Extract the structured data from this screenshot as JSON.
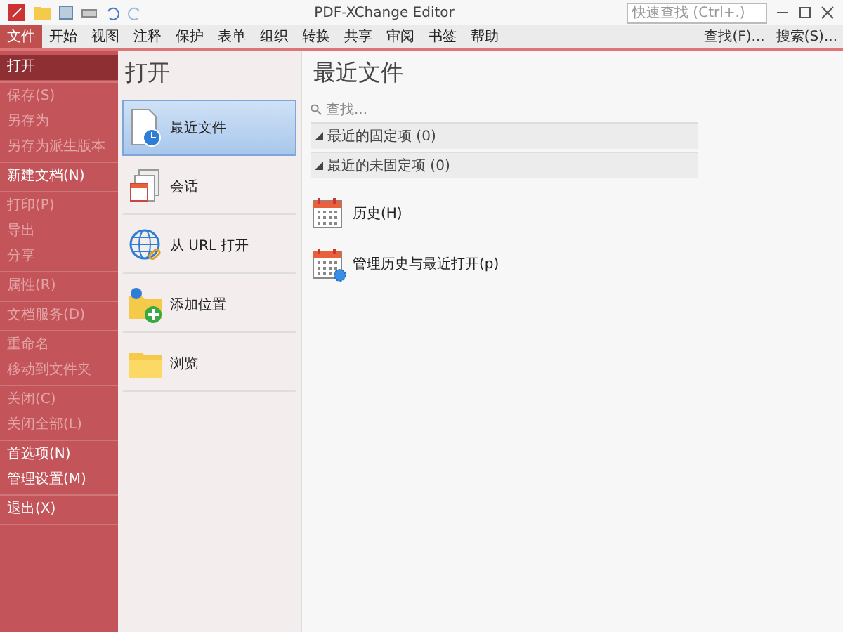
{
  "window": {
    "title": "PDF-XChange Editor",
    "search_placeholder": "快速查找 (Ctrl+.)"
  },
  "menu_tabs": [
    {
      "label": "文件",
      "selected": true
    },
    {
      "label": "开始",
      "selected": false
    },
    {
      "label": "视图",
      "selected": false
    },
    {
      "label": "注释",
      "selected": false
    },
    {
      "label": "保护",
      "selected": false
    },
    {
      "label": "表单",
      "selected": false
    },
    {
      "label": "组织",
      "selected": false
    },
    {
      "label": "转换",
      "selected": false
    },
    {
      "label": "共享",
      "selected": false
    },
    {
      "label": "审阅",
      "selected": false
    },
    {
      "label": "书签",
      "selected": false
    },
    {
      "label": "帮助",
      "selected": false
    }
  ],
  "ribbon_tools": [
    {
      "label": "查找(F)..."
    },
    {
      "label": "搜索(S)..."
    }
  ],
  "sidebar": {
    "groups": [
      [
        {
          "label": "打开",
          "selected": true,
          "disabled": false
        }
      ],
      [
        {
          "label": "保存(S)",
          "selected": false,
          "disabled": true
        },
        {
          "label": "另存为",
          "selected": false,
          "disabled": true
        },
        {
          "label": "另存为派生版本",
          "selected": false,
          "disabled": true
        }
      ],
      [
        {
          "label": "新建文档(N)",
          "selected": false,
          "disabled": false
        }
      ],
      [
        {
          "label": "打印(P)",
          "selected": false,
          "disabled": true
        },
        {
          "label": "导出",
          "selected": false,
          "disabled": true
        },
        {
          "label": "分享",
          "selected": false,
          "disabled": true
        }
      ],
      [
        {
          "label": "属性(R)",
          "selected": false,
          "disabled": true
        }
      ],
      [
        {
          "label": "文档服务(D)",
          "selected": false,
          "disabled": true
        }
      ],
      [
        {
          "label": "重命名",
          "selected": false,
          "disabled": true
        },
        {
          "label": "移动到文件夹",
          "selected": false,
          "disabled": true
        }
      ],
      [
        {
          "label": "关闭(C)",
          "selected": false,
          "disabled": true
        },
        {
          "label": "关闭全部(L)",
          "selected": false,
          "disabled": true
        }
      ],
      [
        {
          "label": "首选项(N)",
          "selected": false,
          "disabled": false
        },
        {
          "label": "管理设置(M)",
          "selected": false,
          "disabled": false
        }
      ],
      [
        {
          "label": "退出(X)",
          "selected": false,
          "disabled": false
        }
      ]
    ]
  },
  "open_panel": {
    "heading": "打开",
    "items": [
      {
        "kind": "recent",
        "label": "最近文件",
        "selected": true
      },
      {
        "kind": "session",
        "label": "会话",
        "selected": false
      },
      {
        "kind": "url",
        "label": "从 URL 打开",
        "selected": false
      },
      {
        "kind": "add",
        "label": "添加位置",
        "selected": false
      },
      {
        "kind": "browse",
        "label": "浏览",
        "selected": false
      }
    ]
  },
  "recent_panel": {
    "heading": "最近文件",
    "search_placeholder": "查找...",
    "groups": [
      {
        "label": "最近的固定项 (0)",
        "expanded": true
      },
      {
        "label": "最近的未固定项 (0)",
        "expanded": true
      }
    ],
    "actions": [
      {
        "kind": "history",
        "label": "历史(H)"
      },
      {
        "kind": "manage",
        "label": "管理历史与最近打开(p)"
      }
    ]
  }
}
